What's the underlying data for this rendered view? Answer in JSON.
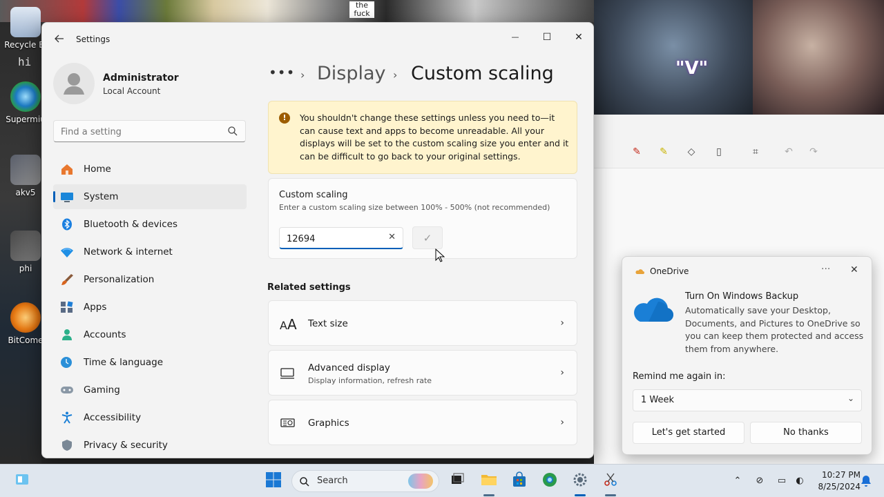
{
  "desktop": {
    "icons": [
      {
        "label": "Recycle Bi"
      },
      {
        "label": "Supermiu"
      },
      {
        "label": "akv5"
      },
      {
        "label": "phi"
      },
      {
        "label": "BitCome"
      }
    ],
    "wallpaper_text_1": "hi",
    "wallpaper_text_2": "the fuck",
    "wallpaper_text_3": "\"V\""
  },
  "settings": {
    "app_title": "Settings",
    "window_controls": {
      "minimize": "—",
      "maximize": "☐",
      "close": "✕"
    },
    "account": {
      "name": "Administrator",
      "type": "Local Account"
    },
    "search": {
      "placeholder": "Find a setting"
    },
    "nav": [
      {
        "label": "Home",
        "icon": "home-icon",
        "active": false
      },
      {
        "label": "System",
        "icon": "system-icon",
        "active": true
      },
      {
        "label": "Bluetooth & devices",
        "icon": "bluetooth-icon",
        "active": false
      },
      {
        "label": "Network & internet",
        "icon": "network-icon",
        "active": false
      },
      {
        "label": "Personalization",
        "icon": "brush-icon",
        "active": false
      },
      {
        "label": "Apps",
        "icon": "apps-icon",
        "active": false
      },
      {
        "label": "Accounts",
        "icon": "accounts-icon",
        "active": false
      },
      {
        "label": "Time & language",
        "icon": "clock-icon",
        "active": false
      },
      {
        "label": "Gaming",
        "icon": "gamepad-icon",
        "active": false
      },
      {
        "label": "Accessibility",
        "icon": "accessibility-icon",
        "active": false
      },
      {
        "label": "Privacy & security",
        "icon": "shield-icon",
        "active": false
      }
    ],
    "breadcrumb": {
      "dots": "•••",
      "parent": "Display",
      "current": "Custom scaling"
    },
    "warning": "You shouldn't change these settings unless you need to—it can cause text and apps to become unreadable. All your displays will be set to the custom scaling size you enter and it can be difficult to go back to your original settings.",
    "custom_scaling": {
      "title": "Custom scaling",
      "description": "Enter a custom scaling size between 100% - 500% (not recommended)",
      "value": "12694"
    },
    "related": {
      "heading": "Related settings",
      "items": [
        {
          "title": "Text size",
          "subtitle": ""
        },
        {
          "title": "Advanced display",
          "subtitle": "Display information, refresh rate"
        },
        {
          "title": "Graphics",
          "subtitle": ""
        }
      ]
    }
  },
  "toast": {
    "app": "OneDrive",
    "more": "···",
    "title": "Turn On Windows Backup",
    "body": "Automatically save your Desktop, Documents, and Pictures to OneDrive so you can keep them protected and access them from anywhere.",
    "remind_label": "Remind me again in:",
    "remind_value": "1 Week",
    "primary_button": "Let's get started",
    "secondary_button": "No thanks"
  },
  "taskbar": {
    "search_label": "Search",
    "time": "10:27 PM",
    "date": "8/25/2024"
  },
  "colors": {
    "accent": "#005fb8",
    "warning_bg": "#fff4ce",
    "onedrive_blue": "#1a7fd6"
  }
}
